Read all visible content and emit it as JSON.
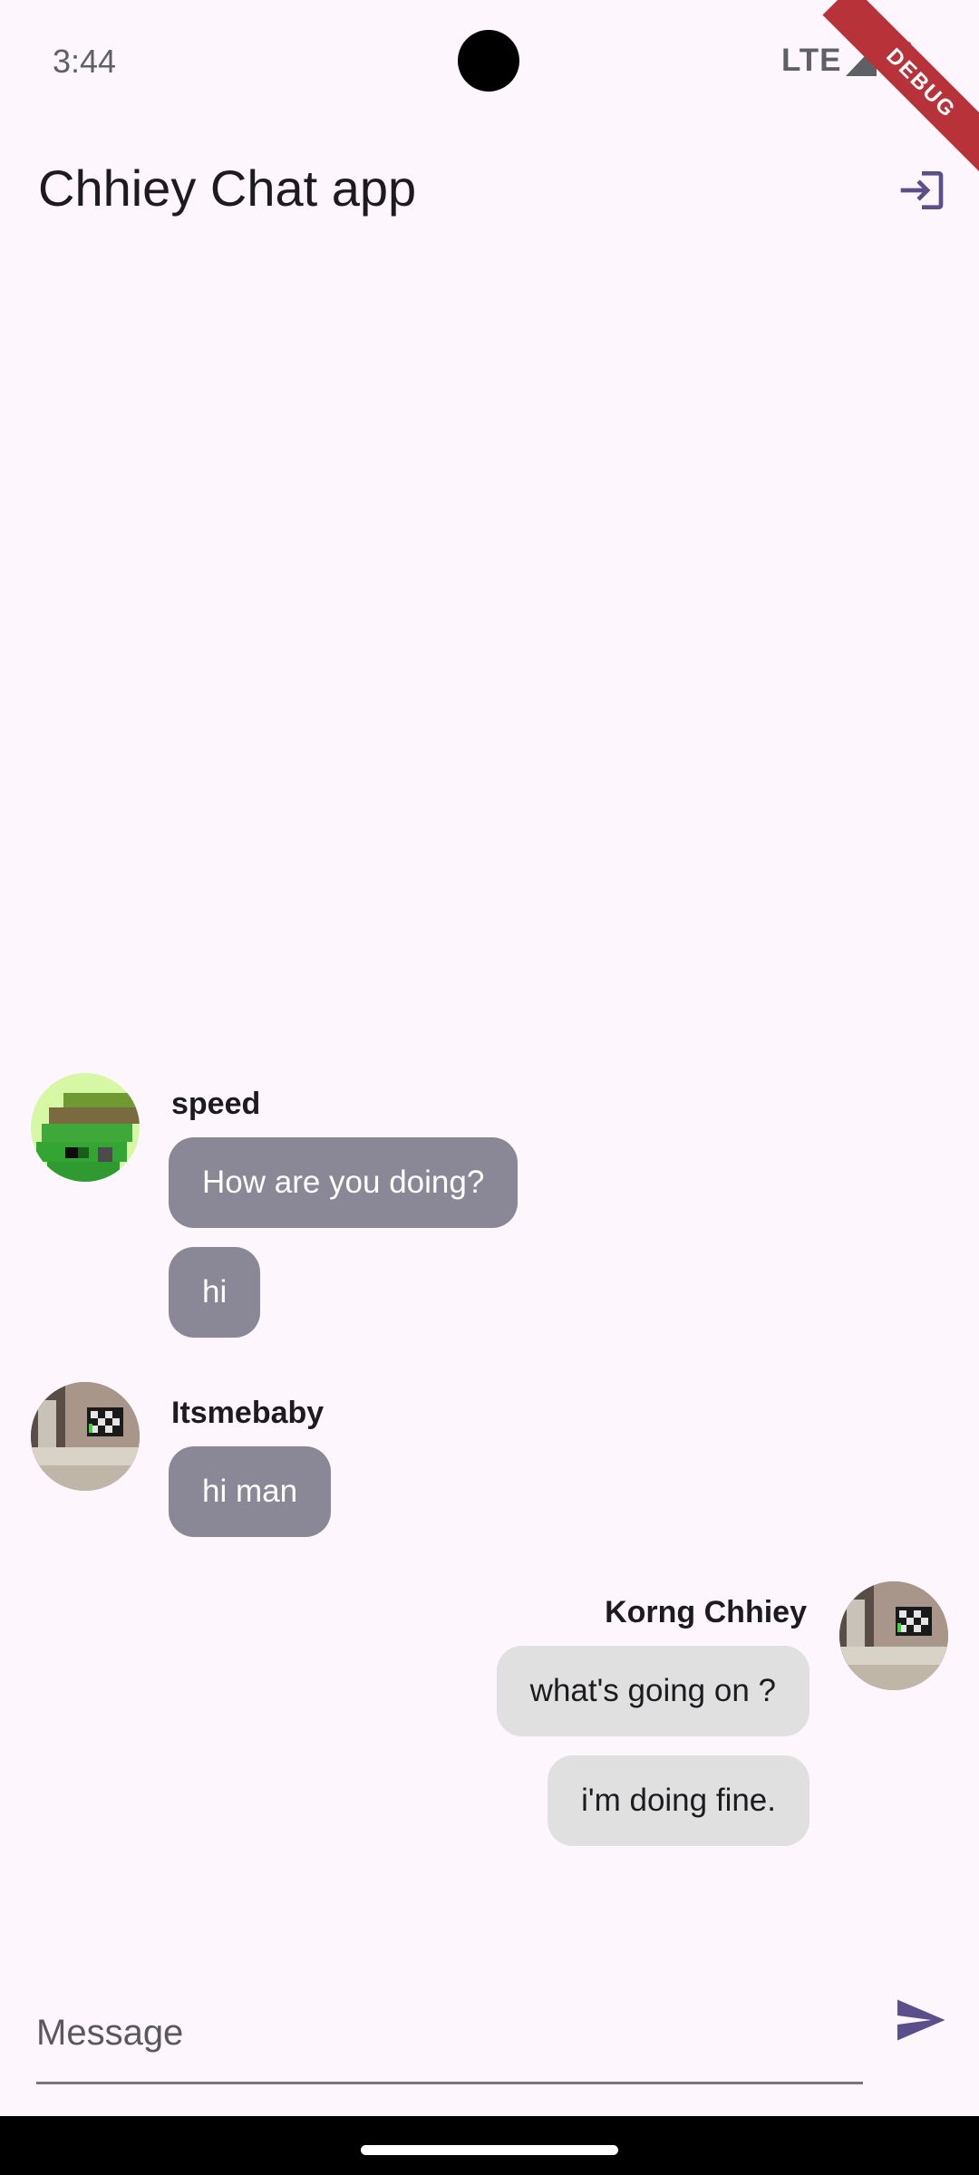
{
  "status_bar": {
    "time": "3:44",
    "network": "LTE",
    "debug_label": "DEBUG"
  },
  "app_bar": {
    "title": "Chhiey Chat app",
    "logout_icon": "logout-icon"
  },
  "messages": [
    {
      "sender": "speed",
      "avatar": "pixel-art-avatar",
      "texts": [
        "How are you doing?",
        "hi"
      ]
    },
    {
      "sender": "Itsmebaby",
      "avatar": "room-photo-avatar",
      "texts": [
        "hi man"
      ]
    },
    {
      "sender": "Korng Chhiey",
      "avatar": "room-photo-avatar",
      "own": true,
      "texts": [
        "what's going on ?",
        "i'm doing fine."
      ]
    }
  ],
  "composer": {
    "placeholder": "Message",
    "value": "",
    "send_icon": "send-icon"
  },
  "colors": {
    "background": "#fdf7fd",
    "incoming_bubble": "#8a8797",
    "outgoing_bubble": "#e0e0e0",
    "accent": "#5a4f8a",
    "debug_banner": "#b8323a"
  }
}
